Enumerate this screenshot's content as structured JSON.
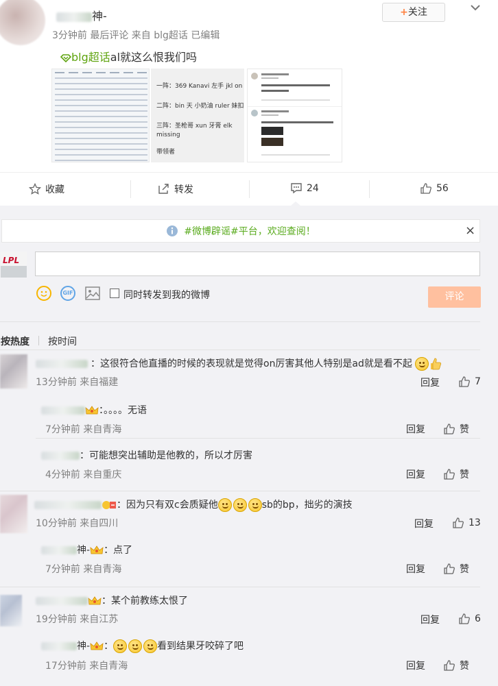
{
  "post": {
    "author_suffix": "神-",
    "follow_label": "关注",
    "meta": "3分钟前 最后评论 来自 blg超话 已编辑",
    "topic": "blg超话",
    "text": "al就这么恨我们吗",
    "img2_lines": [
      "一阵：369 Kanavi 左手 jkl on",
      "二阵：bin 天 小奶油 ruler 妹扣",
      "三阵：圣枪哥 xun 牙膏 elk missing",
      "带领者"
    ]
  },
  "actions": {
    "favorite": "收藏",
    "forward": "转发",
    "comment_count": "24",
    "like_count": "56"
  },
  "notice": {
    "text": "#微博辟谣#平台，欢迎查阅！",
    "close": "×"
  },
  "composer": {
    "avatar_text": "LPL",
    "sync_label": "同时转发到我的微博",
    "submit_label": "评论"
  },
  "sort": {
    "hot": "按热度",
    "time": "按时间"
  },
  "comments": [
    {
      "text": "：这很符合他直播的时候的表现就是觉得on厉害其他人特别是ad就是看不起",
      "meta": "13分钟前 来自福建",
      "reply": "回复",
      "likes": "7",
      "replies": [
        {
          "text": "：。。。。无语",
          "meta": "7分钟前 来自青海",
          "reply": "回复",
          "like": "赞"
        },
        {
          "text": "：可能想突出辅助是他教的，所以才厉害",
          "meta": "4分钟前 来自重庆",
          "reply": "回复",
          "like": "赞"
        }
      ]
    },
    {
      "text": "：因为只有双c会质疑他",
      "text_tail": "sb的bp，拙劣的演技",
      "meta": "10分钟前 来自四川",
      "reply": "回复",
      "likes": "13",
      "replies": [
        {
          "name_suffix": "神-",
          "text": "：点了",
          "meta": "7分钟前 来自青海",
          "reply": "回复",
          "like": "赞"
        }
      ]
    },
    {
      "text": "：某个前教练太恨了",
      "meta": "19分钟前 来自江苏",
      "reply": "回复",
      "likes": "6",
      "replies": [
        {
          "name_suffix": "神-",
          "text": "：",
          "text_tail": "看到结果牙咬碎了吧",
          "meta": "17分钟前 来自青海",
          "reply": "回复",
          "like": "赞"
        }
      ]
    }
  ],
  "colors": {
    "accent_orange": "#ff8140",
    "topic_green": "#5fa40f",
    "notice_green": "#5aab1e",
    "submit_bg": "#ffc09f"
  }
}
